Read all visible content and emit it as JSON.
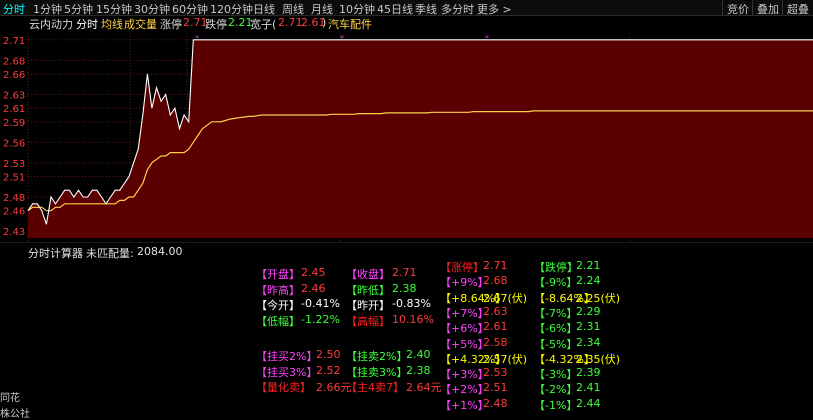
{
  "tabs": [
    "分时",
    "1分钟",
    "5分钟",
    "15分钟",
    "30分钟",
    "60分钟",
    "120分钟",
    "日线",
    "周线",
    "月线",
    "10分钟",
    "45日线",
    "季线",
    "多分时",
    "更多 >"
  ],
  "right_buttons": [
    "竞价",
    "叠加",
    "超叠"
  ],
  "info": {
    "stock_name": "云内动力",
    "mode": "分时",
    "avg_label": "均线",
    "vol_label": "成交量",
    "limit_up_label": "涨停",
    "limit_up_value": "2.71",
    "limit_down_label": "跌停",
    "limit_down_value": "2.21",
    "bracket_label": "宽子(",
    "bracket_v1": "2.71",
    "bracket_v2": "2.61",
    "bracket_close": ")",
    "sector": "汽车配件"
  },
  "chart_data": {
    "type": "line",
    "y_ticks": [
      "2.71",
      "2.68",
      "2.66",
      "2.63",
      "2.61",
      "2.59",
      "2.56",
      "2.53",
      "2.51",
      "2.48",
      "2.46",
      "2.43"
    ],
    "ylim": [
      2.42,
      2.72
    ],
    "grid": true,
    "series": [
      {
        "values": [
          2.46,
          2.47,
          2.47,
          2.46,
          2.44,
          2.48,
          2.47,
          2.48,
          2.49,
          2.49,
          2.48,
          2.49,
          2.48,
          2.48,
          2.49,
          2.49,
          2.48,
          2.47,
          2.48,
          2.49,
          2.49,
          2.5,
          2.51,
          2.53,
          2.55,
          2.6,
          2.66,
          2.61,
          2.64,
          2.62,
          2.63,
          2.6,
          2.61,
          2.58,
          2.6,
          2.59,
          2.71,
          2.71,
          2.71,
          2.71,
          2.71,
          2.71,
          2.71,
          2.71,
          2.71,
          2.71,
          2.71,
          2.71,
          2.71,
          2.71,
          2.71,
          2.71,
          2.71,
          2.71,
          2.71,
          2.71,
          2.71,
          2.71,
          2.71,
          2.71,
          2.71,
          2.71,
          2.71,
          2.71,
          2.71,
          2.71,
          2.71,
          2.71,
          2.71,
          2.71,
          2.71,
          2.71,
          2.71,
          2.71,
          2.71,
          2.71,
          2.71,
          2.71,
          2.71,
          2.71,
          2.71,
          2.71,
          2.71,
          2.71,
          2.71,
          2.71,
          2.71,
          2.71,
          2.71,
          2.71,
          2.71,
          2.71,
          2.71,
          2.71,
          2.71,
          2.71,
          2.71,
          2.71,
          2.71,
          2.71,
          2.71,
          2.71,
          2.71,
          2.71,
          2.71,
          2.71,
          2.71,
          2.71,
          2.71,
          2.71,
          2.71,
          2.71,
          2.71,
          2.71,
          2.71,
          2.71,
          2.71,
          2.71,
          2.71,
          2.71,
          2.71,
          2.71,
          2.71,
          2.71,
          2.71,
          2.71,
          2.71,
          2.71,
          2.71,
          2.71,
          2.71,
          2.71,
          2.71,
          2.71,
          2.71,
          2.71,
          2.71,
          2.71,
          2.71,
          2.71,
          2.71,
          2.71,
          2.71,
          2.71,
          2.71,
          2.71,
          2.71,
          2.71,
          2.71,
          2.71,
          2.71,
          2.71,
          2.71,
          2.71,
          2.71,
          2.71,
          2.71,
          2.71,
          2.71,
          2.71,
          2.71,
          2.71,
          2.71,
          2.71,
          2.71,
          2.71,
          2.71,
          2.71,
          2.71,
          2.71,
          2.71,
          2.71
        ]
      },
      {
        "values": [
          2.46,
          2.465,
          2.465,
          2.465,
          2.46,
          2.46,
          2.465,
          2.465,
          2.47,
          2.47,
          2.47,
          2.47,
          2.47,
          2.47,
          2.47,
          2.47,
          2.47,
          2.47,
          2.47,
          2.47,
          2.475,
          2.475,
          2.48,
          2.48,
          2.49,
          2.5,
          2.52,
          2.53,
          2.535,
          2.54,
          2.54,
          2.545,
          2.545,
          2.545,
          2.545,
          2.55,
          2.56,
          2.57,
          2.58,
          2.585,
          2.59,
          2.59,
          2.59,
          2.592,
          2.594,
          2.595,
          2.596,
          2.597,
          2.598,
          2.598,
          2.599,
          2.6,
          2.6,
          2.6,
          2.6,
          2.6,
          2.6,
          2.6,
          2.6,
          2.6,
          2.6,
          2.6,
          2.6,
          2.6,
          2.6,
          2.6,
          2.601,
          2.601,
          2.601,
          2.601,
          2.601,
          2.601,
          2.602,
          2.602,
          2.602,
          2.602,
          2.602,
          2.602,
          2.603,
          2.603,
          2.603,
          2.603,
          2.603,
          2.603,
          2.603,
          2.603,
          2.603,
          2.603,
          2.604,
          2.604,
          2.604,
          2.604,
          2.604,
          2.604,
          2.604,
          2.604,
          2.604,
          2.605,
          2.605,
          2.605,
          2.605,
          2.605,
          2.605,
          2.605,
          2.605,
          2.605,
          2.605,
          2.605,
          2.605,
          2.605,
          2.606,
          2.606,
          2.606,
          2.606,
          2.606,
          2.606,
          2.606,
          2.606,
          2.606,
          2.606,
          2.606,
          2.606,
          2.606,
          2.606,
          2.606,
          2.606,
          2.606,
          2.606,
          2.606,
          2.606,
          2.606,
          2.606,
          2.606,
          2.606,
          2.606,
          2.606,
          2.606,
          2.606,
          2.606,
          2.606,
          2.606,
          2.606,
          2.606,
          2.606,
          2.606,
          2.606,
          2.606,
          2.606,
          2.606,
          2.606,
          2.606,
          2.606,
          2.606,
          2.606,
          2.606,
          2.606,
          2.606,
          2.606,
          2.606,
          2.606,
          2.606,
          2.606,
          2.606,
          2.606,
          2.606,
          2.606,
          2.606,
          2.606,
          2.606,
          2.606,
          2.606,
          2.606,
          2.606
        ]
      }
    ]
  },
  "calc": {
    "title": "分时计算器",
    "unmatched_label": "未匹配量:",
    "unmatched_value": "2084.00"
  },
  "left_cut": [
    "同花",
    "株公社"
  ],
  "colA": [
    {
      "label": "【开盘】",
      "value": "2.45",
      "lc": "#ff44ff",
      "vc": "#ff3b3b"
    },
    {
      "label": "【昨高】",
      "value": "2.46",
      "lc": "#ff44ff",
      "vc": "#ff3b3b"
    },
    {
      "label": "【今开】",
      "value": "-0.41%",
      "lc": "#ffffff",
      "vc": "#ffffff"
    },
    {
      "label": "【低幅】",
      "value": "-1.22%",
      "lc": "#3cff3c",
      "vc": "#3cff3c"
    }
  ],
  "colB": [
    {
      "label": "【收盘】",
      "value": "2.71",
      "lc": "#ff44ff",
      "vc": "#ff3b3b"
    },
    {
      "label": "【昨低】",
      "value": "2.38",
      "lc": "#3cff3c",
      "vc": "#3cff3c"
    },
    {
      "label": "【昨开】",
      "value": "-0.83%",
      "lc": "#ffffff",
      "vc": "#ffffff"
    },
    {
      "label": "【高幅】",
      "value": "10.16%",
      "lc": "#ff2020",
      "vc": "#ff3b3b"
    }
  ],
  "colA2": [
    {
      "label": "【挂买2%】",
      "value": "2.50",
      "lc": "#ff44ff",
      "vc": "#ff3b3b"
    },
    {
      "label": "【挂买3%】",
      "value": "2.52",
      "lc": "#ff44ff",
      "vc": "#ff3b3b"
    },
    {
      "label": "【量化卖】",
      "value": "2.66元",
      "lc": "#ff2020",
      "vc": "#ff3b3b"
    }
  ],
  "colB2": [
    {
      "label": "【挂卖2%】",
      "value": "2.40",
      "lc": "#3cff3c",
      "vc": "#3cff3c"
    },
    {
      "label": "【挂卖3%】",
      "value": "2.38",
      "lc": "#3cff3c",
      "vc": "#3cff3c"
    },
    {
      "label": "【主4卖7】",
      "value": "2.64元",
      "lc": "#ff2020",
      "vc": "#ff3b3b"
    }
  ],
  "colC": [
    {
      "label": "【涨停】",
      "value": "2.71",
      "lc": "#ff2020",
      "vc": "#ff3b3b"
    },
    {
      "label": "【+9%】",
      "value": "2.68",
      "lc": "#ff44ff",
      "vc": "#ff3b3b"
    },
    {
      "label": "【+8.64%】",
      "value": "2.67(伏)",
      "lc": "#ffff00",
      "vc": "#ffff00"
    },
    {
      "label": "【+7%】",
      "value": "2.63",
      "lc": "#ff44ff",
      "vc": "#ff3b3b"
    },
    {
      "label": "【+6%】",
      "value": "2.61",
      "lc": "#ff44ff",
      "vc": "#ff3b3b"
    },
    {
      "label": "【+5%】",
      "value": "2.58",
      "lc": "#ff44ff",
      "vc": "#ff3b3b"
    },
    {
      "label": "【+4.32%】",
      "value": "2.57(伏)",
      "lc": "#ffff00",
      "vc": "#ffff00"
    },
    {
      "label": "【+3%】",
      "value": "2.53",
      "lc": "#ff44ff",
      "vc": "#ff3b3b"
    },
    {
      "label": "【+2%】",
      "value": "2.51",
      "lc": "#ff44ff",
      "vc": "#ff3b3b"
    },
    {
      "label": "【+1%】",
      "value": "2.48",
      "lc": "#ff44ff",
      "vc": "#ff3b3b"
    }
  ],
  "colD": [
    {
      "label": "【跌停】",
      "value": "2.21",
      "lc": "#3cff3c",
      "vc": "#3cff3c"
    },
    {
      "label": "【-9%】",
      "value": "2.24",
      "lc": "#3cff3c",
      "vc": "#3cff3c"
    },
    {
      "label": "【-8.64%】",
      "value": "2.25(伏)",
      "lc": "#ffff00",
      "vc": "#ffff00"
    },
    {
      "label": "【-7%】",
      "value": "2.29",
      "lc": "#3cff3c",
      "vc": "#3cff3c"
    },
    {
      "label": "【-6%】",
      "value": "2.31",
      "lc": "#3cff3c",
      "vc": "#3cff3c"
    },
    {
      "label": "【-5%】",
      "value": "2.34",
      "lc": "#3cff3c",
      "vc": "#3cff3c"
    },
    {
      "label": "【-4.32%】",
      "value": "2.35(伏)",
      "lc": "#ffff00",
      "vc": "#ffff00"
    },
    {
      "label": "【-3%】",
      "value": "2.39",
      "lc": "#3cff3c",
      "vc": "#3cff3c"
    },
    {
      "label": "【-2%】",
      "value": "2.41",
      "lc": "#3cff3c",
      "vc": "#3cff3c"
    },
    {
      "label": "【-1%】",
      "value": "2.44",
      "lc": "#3cff3c",
      "vc": "#3cff3c"
    }
  ],
  "colors": {
    "price_line": "#ffffff",
    "avg_line": "#ffd24a",
    "fill": "#5a0000",
    "accent": "#00ffff",
    "up": "#ff3b3b",
    "down": "#3cff3c"
  }
}
